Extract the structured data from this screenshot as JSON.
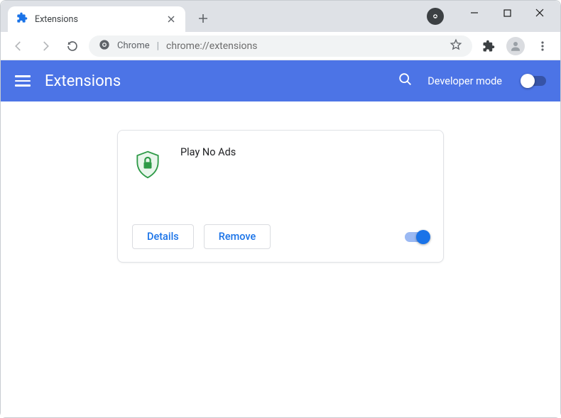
{
  "window": {
    "tab_title": "Extensions"
  },
  "addressbar": {
    "scheme_label": "Chrome",
    "url": "chrome://extensions"
  },
  "header": {
    "title": "Extensions",
    "devmode_label": "Developer mode"
  },
  "extension": {
    "name": "Play No Ads",
    "details_label": "Details",
    "remove_label": "Remove"
  }
}
